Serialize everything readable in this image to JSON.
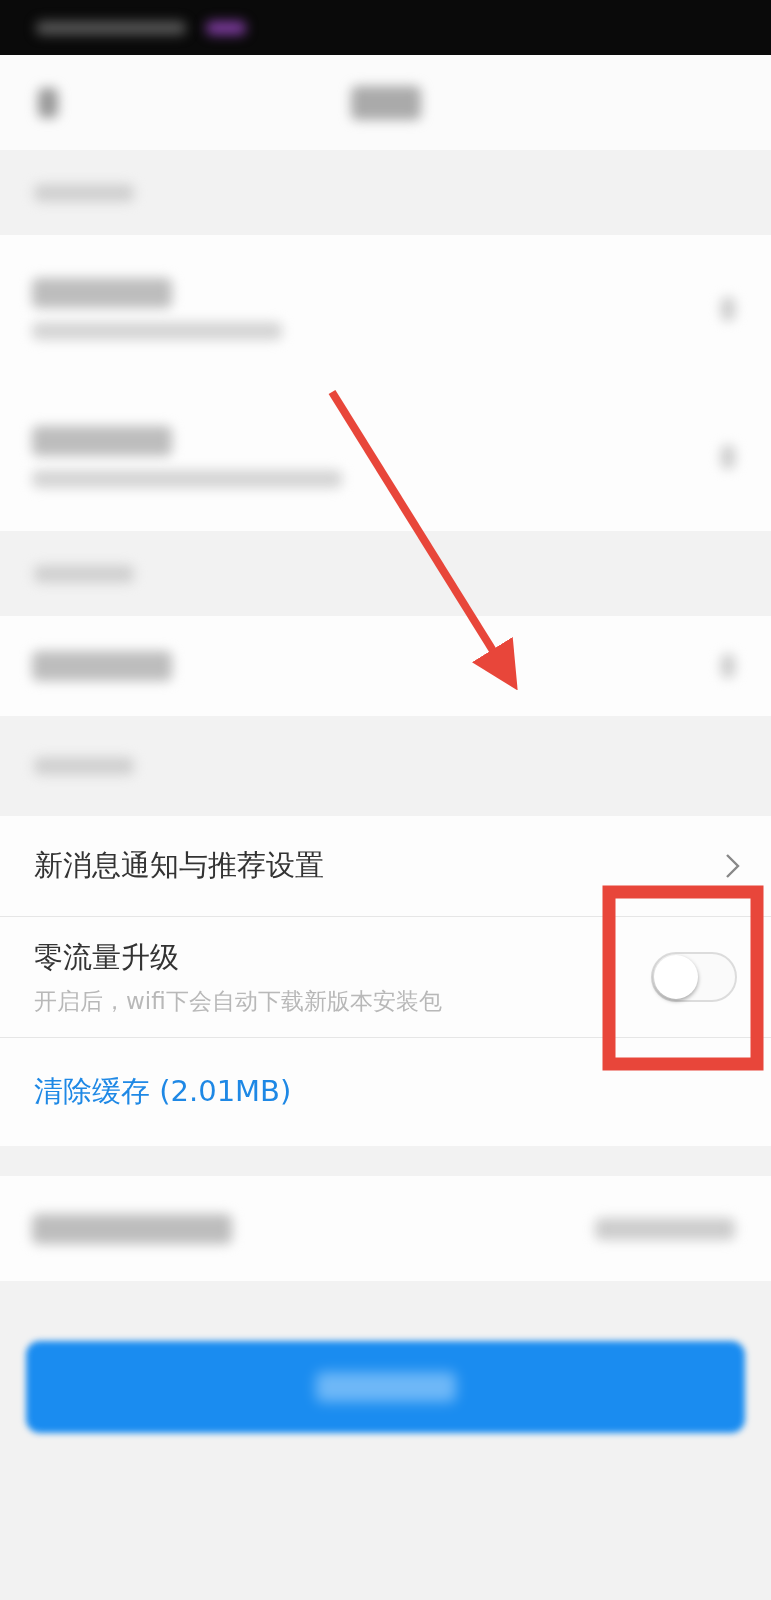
{
  "settings_group": [
    {
      "kind": "link",
      "label": "新消息通知与推荐设置"
    },
    {
      "kind": "toggle",
      "label": "零流量升级",
      "description": "开启后，wifi下会自动下载新版本安装包",
      "on": false
    },
    {
      "kind": "action",
      "label": "清除缓存 (2.01MB)"
    }
  ]
}
